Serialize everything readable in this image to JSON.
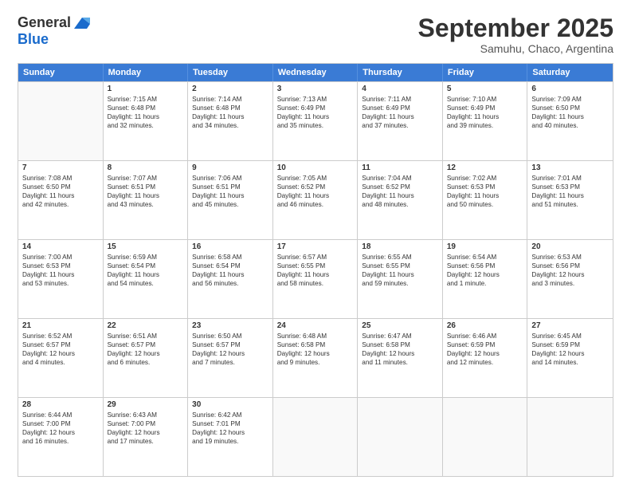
{
  "logo": {
    "general": "General",
    "blue": "Blue"
  },
  "title": "September 2025",
  "subtitle": "Samuhu, Chaco, Argentina",
  "header_days": [
    "Sunday",
    "Monday",
    "Tuesday",
    "Wednesday",
    "Thursday",
    "Friday",
    "Saturday"
  ],
  "weeks": [
    [
      {
        "day": "",
        "empty": true,
        "lines": []
      },
      {
        "day": "1",
        "lines": [
          "Sunrise: 7:15 AM",
          "Sunset: 6:48 PM",
          "Daylight: 11 hours",
          "and 32 minutes."
        ]
      },
      {
        "day": "2",
        "lines": [
          "Sunrise: 7:14 AM",
          "Sunset: 6:48 PM",
          "Daylight: 11 hours",
          "and 34 minutes."
        ]
      },
      {
        "day": "3",
        "lines": [
          "Sunrise: 7:13 AM",
          "Sunset: 6:49 PM",
          "Daylight: 11 hours",
          "and 35 minutes."
        ]
      },
      {
        "day": "4",
        "lines": [
          "Sunrise: 7:11 AM",
          "Sunset: 6:49 PM",
          "Daylight: 11 hours",
          "and 37 minutes."
        ]
      },
      {
        "day": "5",
        "lines": [
          "Sunrise: 7:10 AM",
          "Sunset: 6:49 PM",
          "Daylight: 11 hours",
          "and 39 minutes."
        ]
      },
      {
        "day": "6",
        "lines": [
          "Sunrise: 7:09 AM",
          "Sunset: 6:50 PM",
          "Daylight: 11 hours",
          "and 40 minutes."
        ]
      }
    ],
    [
      {
        "day": "7",
        "lines": [
          "Sunrise: 7:08 AM",
          "Sunset: 6:50 PM",
          "Daylight: 11 hours",
          "and 42 minutes."
        ]
      },
      {
        "day": "8",
        "lines": [
          "Sunrise: 7:07 AM",
          "Sunset: 6:51 PM",
          "Daylight: 11 hours",
          "and 43 minutes."
        ]
      },
      {
        "day": "9",
        "lines": [
          "Sunrise: 7:06 AM",
          "Sunset: 6:51 PM",
          "Daylight: 11 hours",
          "and 45 minutes."
        ]
      },
      {
        "day": "10",
        "lines": [
          "Sunrise: 7:05 AM",
          "Sunset: 6:52 PM",
          "Daylight: 11 hours",
          "and 46 minutes."
        ]
      },
      {
        "day": "11",
        "lines": [
          "Sunrise: 7:04 AM",
          "Sunset: 6:52 PM",
          "Daylight: 11 hours",
          "and 48 minutes."
        ]
      },
      {
        "day": "12",
        "lines": [
          "Sunrise: 7:02 AM",
          "Sunset: 6:53 PM",
          "Daylight: 11 hours",
          "and 50 minutes."
        ]
      },
      {
        "day": "13",
        "lines": [
          "Sunrise: 7:01 AM",
          "Sunset: 6:53 PM",
          "Daylight: 11 hours",
          "and 51 minutes."
        ]
      }
    ],
    [
      {
        "day": "14",
        "lines": [
          "Sunrise: 7:00 AM",
          "Sunset: 6:53 PM",
          "Daylight: 11 hours",
          "and 53 minutes."
        ]
      },
      {
        "day": "15",
        "lines": [
          "Sunrise: 6:59 AM",
          "Sunset: 6:54 PM",
          "Daylight: 11 hours",
          "and 54 minutes."
        ]
      },
      {
        "day": "16",
        "lines": [
          "Sunrise: 6:58 AM",
          "Sunset: 6:54 PM",
          "Daylight: 11 hours",
          "and 56 minutes."
        ]
      },
      {
        "day": "17",
        "lines": [
          "Sunrise: 6:57 AM",
          "Sunset: 6:55 PM",
          "Daylight: 11 hours",
          "and 58 minutes."
        ]
      },
      {
        "day": "18",
        "lines": [
          "Sunrise: 6:55 AM",
          "Sunset: 6:55 PM",
          "Daylight: 11 hours",
          "and 59 minutes."
        ]
      },
      {
        "day": "19",
        "lines": [
          "Sunrise: 6:54 AM",
          "Sunset: 6:56 PM",
          "Daylight: 12 hours",
          "and 1 minute."
        ]
      },
      {
        "day": "20",
        "lines": [
          "Sunrise: 6:53 AM",
          "Sunset: 6:56 PM",
          "Daylight: 12 hours",
          "and 3 minutes."
        ]
      }
    ],
    [
      {
        "day": "21",
        "lines": [
          "Sunrise: 6:52 AM",
          "Sunset: 6:57 PM",
          "Daylight: 12 hours",
          "and 4 minutes."
        ]
      },
      {
        "day": "22",
        "lines": [
          "Sunrise: 6:51 AM",
          "Sunset: 6:57 PM",
          "Daylight: 12 hours",
          "and 6 minutes."
        ]
      },
      {
        "day": "23",
        "lines": [
          "Sunrise: 6:50 AM",
          "Sunset: 6:57 PM",
          "Daylight: 12 hours",
          "and 7 minutes."
        ]
      },
      {
        "day": "24",
        "lines": [
          "Sunrise: 6:48 AM",
          "Sunset: 6:58 PM",
          "Daylight: 12 hours",
          "and 9 minutes."
        ]
      },
      {
        "day": "25",
        "lines": [
          "Sunrise: 6:47 AM",
          "Sunset: 6:58 PM",
          "Daylight: 12 hours",
          "and 11 minutes."
        ]
      },
      {
        "day": "26",
        "lines": [
          "Sunrise: 6:46 AM",
          "Sunset: 6:59 PM",
          "Daylight: 12 hours",
          "and 12 minutes."
        ]
      },
      {
        "day": "27",
        "lines": [
          "Sunrise: 6:45 AM",
          "Sunset: 6:59 PM",
          "Daylight: 12 hours",
          "and 14 minutes."
        ]
      }
    ],
    [
      {
        "day": "28",
        "lines": [
          "Sunrise: 6:44 AM",
          "Sunset: 7:00 PM",
          "Daylight: 12 hours",
          "and 16 minutes."
        ]
      },
      {
        "day": "29",
        "lines": [
          "Sunrise: 6:43 AM",
          "Sunset: 7:00 PM",
          "Daylight: 12 hours",
          "and 17 minutes."
        ]
      },
      {
        "day": "30",
        "lines": [
          "Sunrise: 6:42 AM",
          "Sunset: 7:01 PM",
          "Daylight: 12 hours",
          "and 19 minutes."
        ]
      },
      {
        "day": "",
        "empty": true,
        "lines": []
      },
      {
        "day": "",
        "empty": true,
        "lines": []
      },
      {
        "day": "",
        "empty": true,
        "lines": []
      },
      {
        "day": "",
        "empty": true,
        "lines": []
      }
    ]
  ]
}
